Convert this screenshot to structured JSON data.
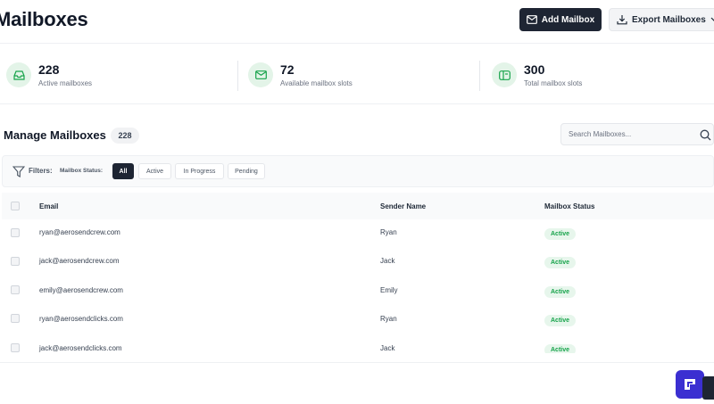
{
  "header": {
    "title": "Mailboxes",
    "add_label": "Add Mailbox",
    "export_label": "Export Mailboxes"
  },
  "stats": [
    {
      "value": "228",
      "label": "Active mailboxes",
      "icon": "inbox-icon"
    },
    {
      "value": "72",
      "label": "Available mailbox slots",
      "icon": "envelope-icon"
    },
    {
      "value": "300",
      "label": "Total mailbox slots",
      "icon": "mailbox-icon"
    }
  ],
  "manage": {
    "title": "Manage Mailboxes",
    "count": "228",
    "search_placeholder": "Search Mailboxes..."
  },
  "filters": {
    "label": "Filters:",
    "status_label": "Mailbox Status:",
    "chips": [
      "All",
      "Active",
      "In Progress",
      "Pending"
    ],
    "selected": "All"
  },
  "table": {
    "columns": [
      "Email",
      "Sender Name",
      "Mailbox Status"
    ],
    "rows": [
      {
        "email": "ryan@aerosendcrew.com",
        "sender": "Ryan",
        "status": "Active"
      },
      {
        "email": "jack@aerosendcrew.com",
        "sender": "Jack",
        "status": "Active"
      },
      {
        "email": "emily@aerosendcrew.com",
        "sender": "Emily",
        "status": "Active"
      },
      {
        "email": "ryan@aerosendclicks.com",
        "sender": "Ryan",
        "status": "Active"
      },
      {
        "email": "jack@aerosendclicks.com",
        "sender": "Jack",
        "status": "Active"
      }
    ]
  },
  "colors": {
    "primary_button": "#1e2533",
    "accent_green": "#16a34a",
    "status_bg": "#e7f6ec",
    "icon_bg": "#e3f4e8",
    "fab": "#3b2fd1"
  }
}
